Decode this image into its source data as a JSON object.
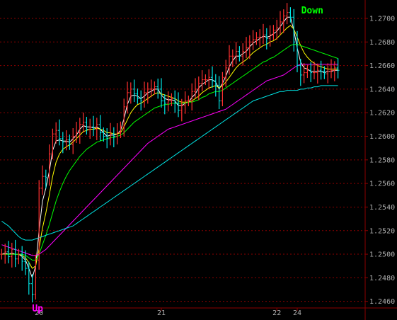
{
  "chart_data": {
    "type": "line",
    "instrument": "",
    "ylim": [
      1.2455,
      1.2712
    ],
    "y_ticks": [
      "1.2460",
      "1.2480",
      "1.2500",
      "1.2520",
      "1.2540",
      "1.2560",
      "1.2580",
      "1.2600",
      "1.2620",
      "1.2640",
      "1.2660",
      "1.2680",
      "1.2700"
    ],
    "x_ticks": [
      {
        "label": "20",
        "index": 11
      },
      {
        "label": "21",
        "index": 47
      },
      {
        "label": "22",
        "index": 81
      },
      {
        "label": "24",
        "index": 87
      }
    ],
    "bar_count": 100,
    "price": [
      1.25,
      1.2502,
      1.2498,
      1.2504,
      1.2496,
      1.25,
      1.2494,
      1.2488,
      1.2475,
      1.2466,
      1.2495,
      1.2556,
      1.2566,
      1.2565,
      1.2585,
      1.2602,
      1.2605,
      1.2598,
      1.2595,
      1.2597,
      1.2593,
      1.26,
      1.2603,
      1.261,
      1.2612,
      1.2606,
      1.2608,
      1.2606,
      1.261,
      1.2603,
      1.26,
      1.2598,
      1.2602,
      1.26,
      1.2603,
      1.2608,
      1.2625,
      1.2637,
      1.264,
      1.2636,
      1.2632,
      1.263,
      1.2637,
      1.264,
      1.264,
      1.2642,
      1.264,
      1.263,
      1.2628,
      1.263,
      1.2632,
      1.2628,
      1.2622,
      1.2626,
      1.263,
      1.263,
      1.2638,
      1.264,
      1.2645,
      1.2648,
      1.2648,
      1.265,
      1.2647,
      1.2643,
      1.263,
      1.265,
      1.2658,
      1.2668,
      1.2668,
      1.2672,
      1.2668,
      1.2672,
      1.2675,
      1.268,
      1.2682,
      1.2684,
      1.2684,
      1.2686,
      1.2683,
      1.2686,
      1.269,
      1.2692,
      1.2697,
      1.2702,
      1.2705,
      1.2701,
      1.268,
      1.266,
      1.2652,
      1.2654,
      1.2656,
      1.2654,
      1.2654,
      1.2656,
      1.2655,
      1.2653,
      1.2655,
      1.2656,
      1.2658,
      1.2656
    ],
    "series": [
      {
        "color": "#ffffff",
        "values": [
          1.25,
          1.2501,
          1.25,
          1.2501,
          1.25,
          1.25,
          1.2498,
          1.2495,
          1.2488,
          1.248,
          1.249,
          1.252,
          1.2545,
          1.2556,
          1.257,
          1.2588,
          1.2596,
          1.2597,
          1.2596,
          1.2596,
          1.2595,
          1.2598,
          1.2601,
          1.2606,
          1.2609,
          1.2608,
          1.2608,
          1.2607,
          1.2608,
          1.2606,
          1.2603,
          1.26,
          1.2601,
          1.2601,
          1.2602,
          1.2605,
          1.2615,
          1.2627,
          1.2634,
          1.2635,
          1.2634,
          1.2632,
          1.2634,
          1.2637,
          1.2638,
          1.264,
          1.264,
          1.2635,
          1.2632,
          1.2631,
          1.2631,
          1.263,
          1.2626,
          1.2626,
          1.2628,
          1.2629,
          1.2633,
          1.2636,
          1.2641,
          1.2644,
          1.2646,
          1.2648,
          1.2648,
          1.2646,
          1.264,
          1.2645,
          1.2651,
          1.2659,
          1.2664,
          1.2668,
          1.2668,
          1.267,
          1.2672,
          1.2676,
          1.2679,
          1.2681,
          1.2683,
          1.2685,
          1.2684,
          1.2685,
          1.2687,
          1.2689,
          1.2693,
          1.2697,
          1.2701,
          1.2701,
          1.269,
          1.2675,
          1.2663,
          1.2658,
          1.2657,
          1.2655,
          1.2655,
          1.2655,
          1.2655,
          1.2654,
          1.2655,
          1.2655,
          1.2656,
          1.2656
        ]
      },
      {
        "color": "#ffff00",
        "values": [
          1.25,
          1.25,
          1.25,
          1.25,
          1.25,
          1.25,
          1.2499,
          1.2497,
          1.2493,
          1.2488,
          1.249,
          1.2505,
          1.2522,
          1.2535,
          1.255,
          1.2566,
          1.2578,
          1.2585,
          1.2589,
          1.2591,
          1.2593,
          1.2595,
          1.2598,
          1.2601,
          1.2604,
          1.2605,
          1.2606,
          1.2606,
          1.2607,
          1.2606,
          1.2605,
          1.2603,
          1.2603,
          1.2602,
          1.2602,
          1.2603,
          1.2608,
          1.2614,
          1.262,
          1.2624,
          1.2627,
          1.2628,
          1.263,
          1.2632,
          1.2634,
          1.2636,
          1.2637,
          1.2636,
          1.2635,
          1.2634,
          1.2633,
          1.2632,
          1.263,
          1.2629,
          1.2629,
          1.2629,
          1.263,
          1.2632,
          1.2634,
          1.2637,
          1.2639,
          1.2641,
          1.2642,
          1.2643,
          1.2641,
          1.2643,
          1.2646,
          1.265,
          1.2654,
          1.2658,
          1.2661,
          1.2663,
          1.2665,
          1.2668,
          1.2671,
          1.2673,
          1.2675,
          1.2677,
          1.2678,
          1.268,
          1.2681,
          1.2683,
          1.2686,
          1.2689,
          1.2692,
          1.2694,
          1.2691,
          1.2684,
          1.2677,
          1.2671,
          1.2667,
          1.2664,
          1.2662,
          1.266,
          1.2659,
          1.2658,
          1.2657,
          1.2657,
          1.2657,
          1.2657
        ]
      },
      {
        "color": "#00ff00",
        "values": [
          1.25,
          1.25,
          1.25,
          1.25,
          1.25,
          1.25,
          1.25,
          1.2499,
          1.2497,
          1.2495,
          1.2495,
          1.25,
          1.2508,
          1.2516,
          1.2525,
          1.2535,
          1.2545,
          1.2553,
          1.256,
          1.2566,
          1.2571,
          1.2575,
          1.2579,
          1.2583,
          1.2586,
          1.2589,
          1.2591,
          1.2593,
          1.2595,
          1.2596,
          1.2597,
          1.2598,
          1.2599,
          1.2599,
          1.26,
          1.2601,
          1.2603,
          1.2606,
          1.2609,
          1.2612,
          1.2614,
          1.2616,
          1.2618,
          1.262,
          1.2622,
          1.2624,
          1.2625,
          1.2626,
          1.2627,
          1.2627,
          1.2628,
          1.2628,
          1.2628,
          1.2628,
          1.2628,
          1.2629,
          1.2629,
          1.263,
          1.2631,
          1.2633,
          1.2634,
          1.2636,
          1.2637,
          1.2638,
          1.2638,
          1.2639,
          1.2641,
          1.2643,
          1.2645,
          1.2647,
          1.2649,
          1.2651,
          1.2653,
          1.2655,
          1.2657,
          1.2659,
          1.2661,
          1.2663,
          1.2664,
          1.2666,
          1.2667,
          1.2669,
          1.2671,
          1.2673,
          1.2675,
          1.2677,
          1.2678,
          1.2678,
          1.2677,
          1.2676,
          1.2675,
          1.2674,
          1.2673,
          1.2672,
          1.2671,
          1.267,
          1.2669,
          1.2668,
          1.2667,
          1.2666
        ]
      },
      {
        "color": "#ff00ff",
        "values": [
          1.2508,
          1.2507,
          1.2506,
          1.2505,
          1.2504,
          1.2503,
          1.2502,
          1.2501,
          1.25,
          1.2499,
          1.2499,
          1.25,
          1.2502,
          1.2504,
          1.2507,
          1.251,
          1.2513,
          1.2516,
          1.2519,
          1.2522,
          1.2525,
          1.2528,
          1.2531,
          1.2534,
          1.2537,
          1.254,
          1.2543,
          1.2546,
          1.2549,
          1.2552,
          1.2555,
          1.2558,
          1.2561,
          1.2564,
          1.2567,
          1.257,
          1.2573,
          1.2576,
          1.2579,
          1.2582,
          1.2585,
          1.2588,
          1.2591,
          1.2594,
          1.2596,
          1.2598,
          1.26,
          1.2602,
          1.2604,
          1.2606,
          1.2607,
          1.2608,
          1.2609,
          1.261,
          1.2611,
          1.2612,
          1.2613,
          1.2614,
          1.2615,
          1.2616,
          1.2617,
          1.2618,
          1.2619,
          1.262,
          1.2621,
          1.2622,
          1.2623,
          1.2625,
          1.2627,
          1.2629,
          1.2631,
          1.2633,
          1.2635,
          1.2637,
          1.2639,
          1.2641,
          1.2643,
          1.2645,
          1.2647,
          1.2648,
          1.2649,
          1.265,
          1.2651,
          1.2652,
          1.2654,
          1.2656,
          1.2658,
          1.266,
          1.2661,
          1.2661,
          1.2661,
          1.2661,
          1.2661,
          1.2661,
          1.2661,
          1.2661,
          1.2661,
          1.2661,
          1.2661,
          1.2661
        ]
      },
      {
        "color": "#00e5e5",
        "values": [
          1.2528,
          1.2526,
          1.2524,
          1.2521,
          1.2518,
          1.2515,
          1.2513,
          1.2512,
          1.2512,
          1.2512,
          1.2513,
          1.2514,
          1.2515,
          1.2516,
          1.2517,
          1.2518,
          1.2519,
          1.252,
          1.2521,
          1.2522,
          1.2523,
          1.2524,
          1.2526,
          1.2528,
          1.253,
          1.2532,
          1.2534,
          1.2536,
          1.2538,
          1.254,
          1.2542,
          1.2544,
          1.2546,
          1.2548,
          1.255,
          1.2552,
          1.2554,
          1.2556,
          1.2558,
          1.256,
          1.2562,
          1.2564,
          1.2566,
          1.2568,
          1.257,
          1.2572,
          1.2574,
          1.2576,
          1.2578,
          1.258,
          1.2582,
          1.2584,
          1.2586,
          1.2588,
          1.259,
          1.2592,
          1.2594,
          1.2596,
          1.2598,
          1.26,
          1.2602,
          1.2604,
          1.2606,
          1.2608,
          1.261,
          1.2612,
          1.2614,
          1.2616,
          1.2618,
          1.262,
          1.2622,
          1.2624,
          1.2626,
          1.2628,
          1.263,
          1.2631,
          1.2632,
          1.2633,
          1.2634,
          1.2635,
          1.2636,
          1.2637,
          1.2638,
          1.2638,
          1.2639,
          1.2639,
          1.2639,
          1.2639,
          1.264,
          1.264,
          1.2641,
          1.2641,
          1.2642,
          1.2642,
          1.2643,
          1.2643,
          1.2643,
          1.2643,
          1.2643,
          1.2643
        ]
      }
    ],
    "signals": [
      {
        "label": "Up",
        "index": 11,
        "color": "#ff00ff"
      },
      {
        "label": "Down",
        "index": 84,
        "color": "#00ff00"
      }
    ],
    "colors": {
      "background": "#000000",
      "axis": "#8b0000",
      "grid": "#8b0000",
      "up_bar": "#ff3030",
      "down_bar": "#00e5e5",
      "tick_text": "#b0b0b0"
    }
  }
}
